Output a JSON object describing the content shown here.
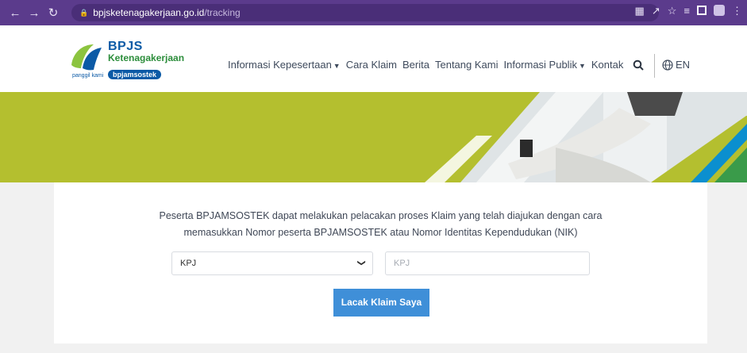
{
  "browser": {
    "back_icon": "arrow-left-icon",
    "url_domain": "bpjsketenagakerjaan.go.id",
    "url_path": "/tracking"
  },
  "logo": {
    "brand": "BPJS",
    "sub": "Ketenagakerjaan",
    "tagline": "panggil kami",
    "pill": "bpjamsostek"
  },
  "nav": {
    "items": [
      {
        "label": "Informasi Kepesertaan",
        "dropdown": true
      },
      {
        "label": "Cara Klaim",
        "dropdown": false
      },
      {
        "label": "Berita",
        "dropdown": false
      },
      {
        "label": "Tentang Kami",
        "dropdown": false
      },
      {
        "label": "Informasi Publik",
        "dropdown": true
      },
      {
        "label": "Kontak",
        "dropdown": false
      }
    ],
    "lang": "EN"
  },
  "tracking": {
    "description_line1": "Peserta BPJAMSOSTEK dapat melakukan pelacakan proses Klaim yang telah diajukan dengan cara",
    "description_line2": "memasukkan Nomor peserta BPJAMSOSTEK atau Nomor Identitas Kependudukan (NIK)",
    "select_value": "KPJ",
    "input_placeholder": "KPJ",
    "submit_label": "Lacak Klaim Saya"
  },
  "colors": {
    "chrome": "#5b3b8c",
    "brand_blue": "#0b5aa6",
    "brand_green": "#2c8d3b",
    "banner": "#b4bf2f",
    "button": "#3f8fd8"
  }
}
